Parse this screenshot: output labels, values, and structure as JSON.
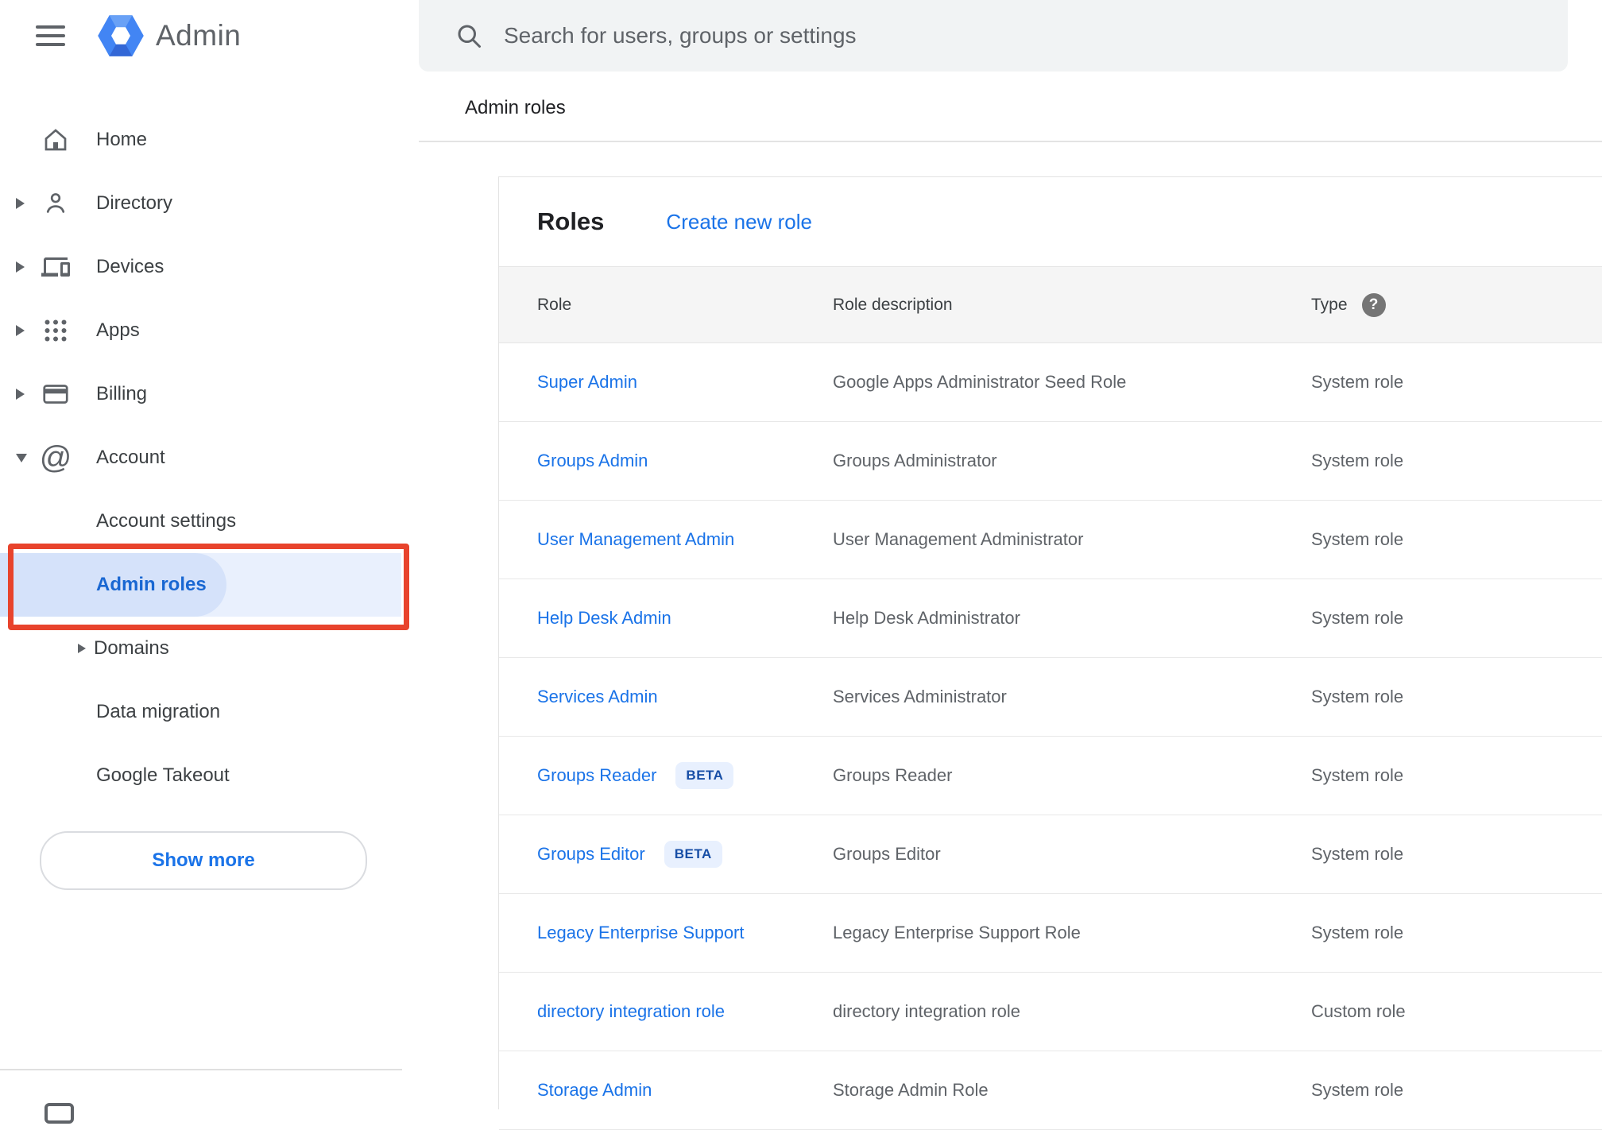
{
  "app": {
    "title": "Admin"
  },
  "search": {
    "placeholder": "Search for users, groups or settings"
  },
  "breadcrumb": "Admin roles",
  "sidebar": {
    "items": [
      {
        "label": "Home",
        "expandable": false
      },
      {
        "label": "Directory",
        "expandable": true
      },
      {
        "label": "Devices",
        "expandable": true
      },
      {
        "label": "Apps",
        "expandable": true
      },
      {
        "label": "Billing",
        "expandable": true
      },
      {
        "label": "Account",
        "expandable": true,
        "expanded": true
      }
    ],
    "account_children": [
      {
        "label": "Account settings"
      },
      {
        "label": "Admin roles",
        "selected": true,
        "annotated": true
      },
      {
        "label": "Domains",
        "expandable": true
      },
      {
        "label": "Data migration"
      },
      {
        "label": "Google Takeout"
      }
    ],
    "show_more_label": "Show more"
  },
  "main": {
    "title": "Roles",
    "create_link": "Create new role",
    "table": {
      "headers": [
        "Role",
        "Role description",
        "Type"
      ],
      "help_icon": "?",
      "rows": [
        {
          "role": "Super Admin",
          "description": "Google Apps Administrator Seed Role",
          "type": "System role"
        },
        {
          "role": "Groups Admin",
          "description": "Groups Administrator",
          "type": "System role"
        },
        {
          "role": "User Management Admin",
          "description": "User Management Administrator",
          "type": "System role"
        },
        {
          "role": "Help Desk Admin",
          "description": "Help Desk Administrator",
          "type": "System role"
        },
        {
          "role": "Services Admin",
          "description": "Services Administrator",
          "type": "System role"
        },
        {
          "role": "Groups Reader",
          "badge": "BETA",
          "description": "Groups Reader",
          "type": "System role"
        },
        {
          "role": "Groups Editor",
          "badge": "BETA",
          "description": "Groups Editor",
          "type": "System role"
        },
        {
          "role": "Legacy Enterprise Support",
          "description": "Legacy Enterprise Support Role",
          "type": "System role"
        },
        {
          "role": "directory integration role",
          "description": "directory integration role",
          "type": "Custom role"
        },
        {
          "role": "Storage Admin",
          "description": "Storage Admin Role",
          "type": "System role"
        }
      ]
    }
  },
  "colors": {
    "link_blue": "#1a73e8",
    "selected_text_blue": "#1967d2",
    "selected_bg": "#e9f0fd",
    "selected_pill": "#d5e2fa",
    "annotation_red": "#e8432c",
    "beta_badge_bg": "#e8f0fe",
    "beta_badge_text": "#174ea6",
    "searchbar_bg": "#f1f3f4",
    "table_header_bg": "#f5f5f5",
    "icon_gray": "#5f6368",
    "logo_blue": "#4285f4"
  }
}
